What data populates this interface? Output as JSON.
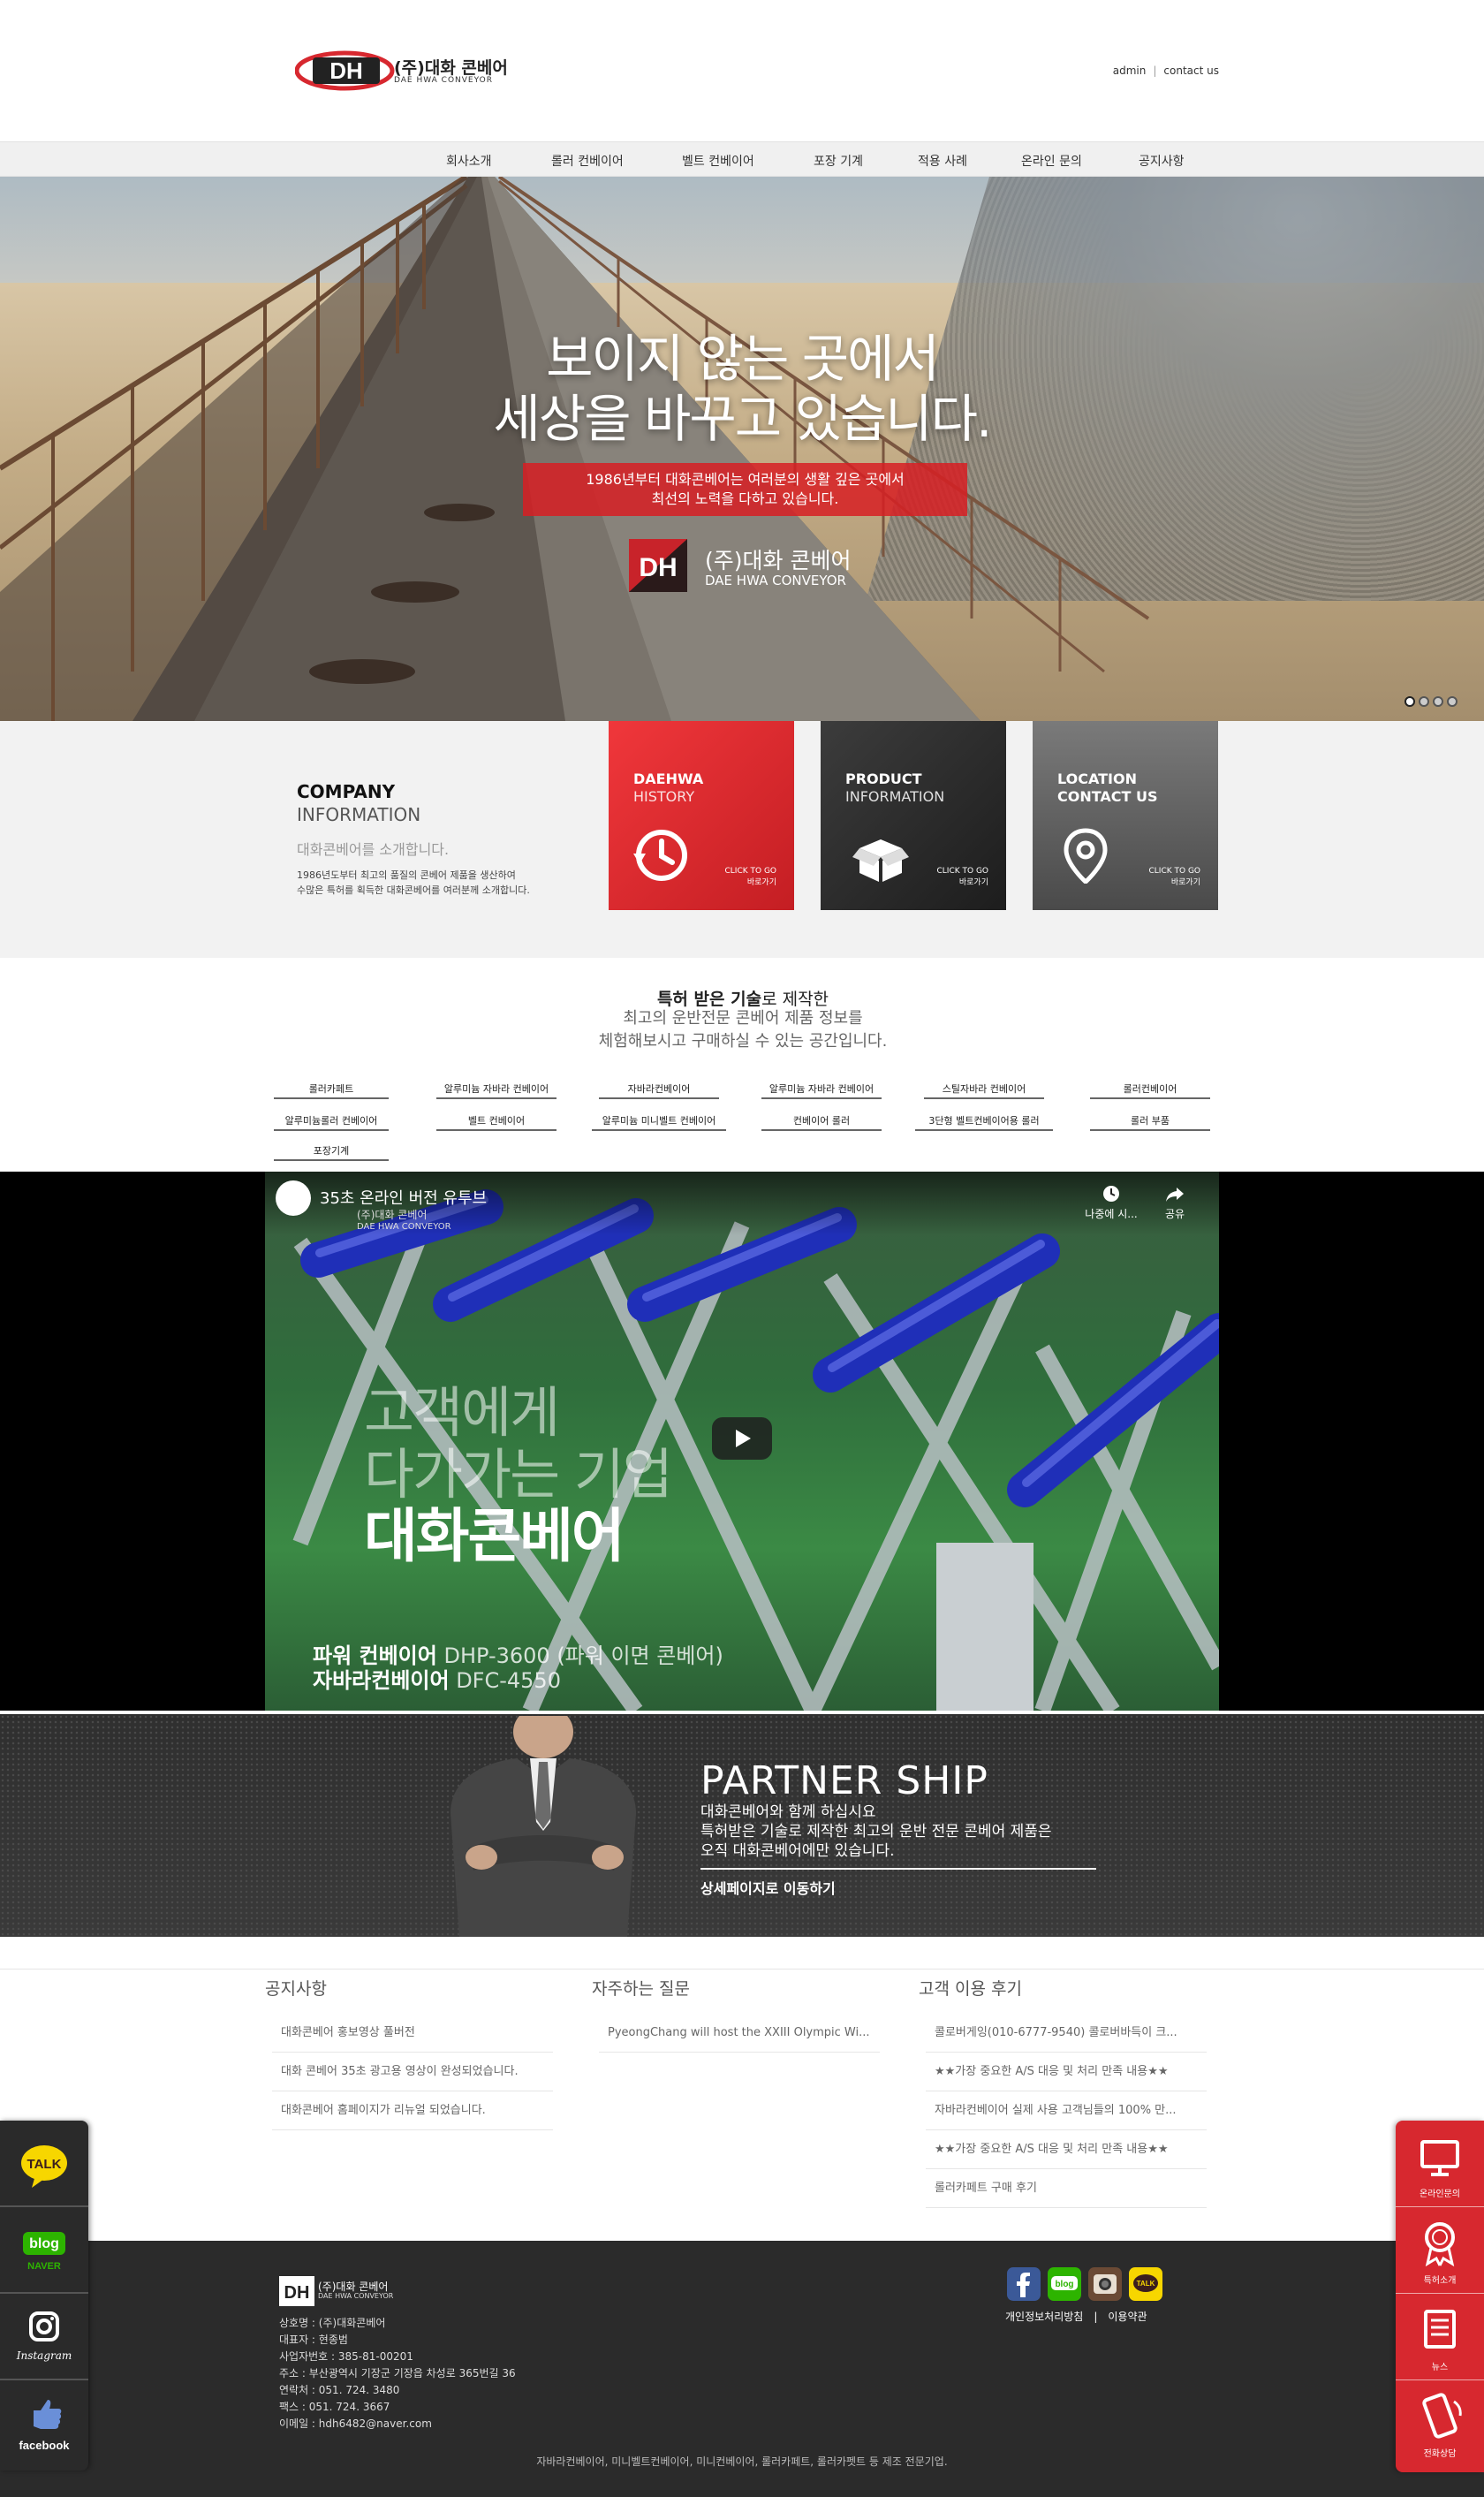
{
  "header": {
    "logo_ko": "(주)대화 콘베어",
    "logo_en": "DAE HWA CONVEYOR",
    "top_links": [
      "admin",
      "contact us"
    ]
  },
  "nav": [
    "회사소개",
    "롤러 컨베이어",
    "벨트 컨베이어",
    "포장 기계",
    "적용 사례",
    "온라인 문의",
    "공지사항"
  ],
  "hero": {
    "title_line1": "보이지 않는 곳에서",
    "title_line2": "세상을 바꾸고 있습니다.",
    "sub_line1": "1986년부터 대화콘베어는 여러분의 생활 깊은 곳에서",
    "sub_line2": "최선의 노력을 다하고 있습니다.",
    "logo_ko": "(주)대화 콘베어",
    "logo_en": "DAE HWA CONVEYOR",
    "slide_count": 4,
    "active_slide": 1
  },
  "info": {
    "company_title": "COMPANY",
    "company_sub": "INFORMATION",
    "company_ko": "대화콘베어를 소개합니다.",
    "company_desc_1": "1986년도부터 최고의 품질의 콘베어 제품을 생산하여",
    "company_desc_2": "수많은 특허를 획득한 대화콘베어를 여러분께 소개합니다.",
    "cards": [
      {
        "t1": "DAEHWA",
        "t2": "HISTORY",
        "go1": "CLICK TO GO",
        "go2": "바로가기",
        "color": "#e52b2f",
        "icon": "clock-icon"
      },
      {
        "t1": "PRODUCT",
        "t2": "INFORMATION",
        "go1": "CLICK TO GO",
        "go2": "바로가기",
        "color": "#2d2d2d",
        "icon": "box-icon"
      },
      {
        "t1": "LOCATION",
        "t2": "CONTACT US",
        "go1": "CLICK TO GO",
        "go2": "바로가기",
        "color": "#5a5a5a",
        "icon": "location-pin-icon"
      }
    ]
  },
  "products": {
    "heading_bold": "특허 받은 기술",
    "heading_rest": "로 제작한",
    "desc_line1": "최고의 운반전문 콘베어 제품 정보를",
    "desc_line2": "체험해보시고 구매하실 수 있는 공간입니다.",
    "tags": [
      "롤러카페트",
      "알루미늄 자바라 컨베이어",
      "자바라컨베이어",
      "알루미늄 자바라 컨베이어",
      "스틸자바라 컨베이어",
      "롤러컨베이어",
      "알루미늄롤러 컨베이어",
      "벨트 컨베이어",
      "알루미늄 미니벨트 컨베이어",
      "컨베이어 롤러",
      "3단형 벨트컨베이어용 롤러",
      "롤러 부품",
      "포장기계"
    ]
  },
  "video": {
    "title": "35초 온라인 버전 유투브",
    "sub": "(주)대화 콘베어",
    "sub_en": "DAE HWA CONVEYOR",
    "watch_later": "나중에 시...",
    "share": "공유",
    "big_line1": "고객에게",
    "big_line2": "다가가는 기업",
    "big_line3": "대화콘베어",
    "caption_line1_bold": "파워 컨베이어",
    "caption_line1_rest": " DHP-3600 (파워 이면 콘베어)",
    "caption_line2_bold": "자바라컨베이어",
    "caption_line2_rest": " DFC-4550"
  },
  "partner": {
    "title": "PARTNER SHIP",
    "desc_line1": "대화콘베어와 함께 하십시요",
    "desc_line2": "특허받은 기술로 제작한 최고의 운반 전문 콘베어 제품은",
    "desc_line3": "오직 대화콘베어에만 있습니다.",
    "link": "상세페이지로 이동하기"
  },
  "boards": {
    "notice": {
      "title": "공지사항",
      "items": [
        "대화콘베어 홍보영상 풀버전",
        "대화 콘베어 35초 광고용 영상이 완성되었습니다.",
        "대화콘베어 홈페이지가 리뉴얼 되었습니다."
      ]
    },
    "faq": {
      "title": "자주하는 질문",
      "items": [
        "PyeongChang will host the XXIII Olympic Wi..."
      ]
    },
    "reviews": {
      "title": "고객 이용 후기",
      "items": [
        "콜로버게잉(010-6777-9540) 콜로버바득이 크...",
        "★★가장 중요한 A/S 대응 및 처리 만족 내용★★",
        "자바라컨베이어 실제 사용 고객님들의 100% 만...",
        "★★가장 중요한 A/S 대응 및 처리 만족 내용★★",
        "롤러카페트 구매 후기"
      ]
    }
  },
  "footer": {
    "logo_ko": "(주)대화 콘베어",
    "logo_en": "DAE HWA CONVEYOR",
    "info": [
      "상호명 : (주)대화콘베어",
      "대표자 : 현종범",
      "사업자번호 : 385-81-00201",
      "주소 : 부산광역시 기장군 기장읍 차성로 365번길 36",
      "연락처 : 051. 724. 3480",
      "팩스 : 051. 724. 3667",
      "이메일 : hdh6482@naver.com"
    ],
    "links": [
      "개인정보처리방침",
      "이용약관"
    ],
    "copy": "자바라컨베이어, 미니벨트컨베이어, 미니컨베이어, 롤러카페트, 롤러카펫트 등 제조 전문기업.",
    "sns": [
      "facebook-icon",
      "blog-icon",
      "instagram-icon",
      "kakaotalk-icon"
    ]
  },
  "left_quick": [
    {
      "icon": "kakaotalk-icon",
      "label": "TALK"
    },
    {
      "icon": "naver-blog-icon",
      "label": "blog",
      "sub": "NAVER"
    },
    {
      "icon": "instagram-icon",
      "label": "Instagram"
    },
    {
      "icon": "facebook-icon",
      "label": "facebook"
    }
  ],
  "right_quick": [
    {
      "icon": "monitor-icon",
      "label": "온라인문의"
    },
    {
      "icon": "award-icon",
      "label": "특허소개"
    },
    {
      "icon": "news-icon",
      "label": "뉴스"
    },
    {
      "icon": "phone-icon",
      "label": "전화상담"
    }
  ],
  "colors": {
    "brand_red": "#d7282f",
    "dark": "#2b2b2b"
  }
}
